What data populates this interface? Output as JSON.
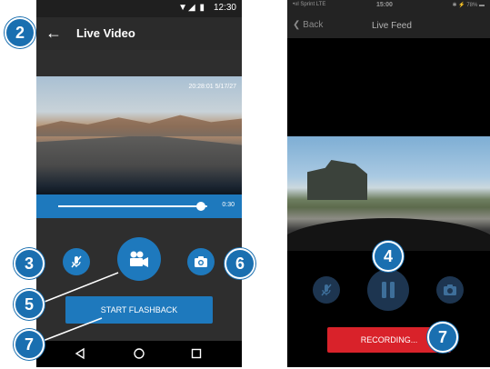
{
  "android": {
    "status": {
      "icons": "▼◢ ▮",
      "time": "12:30"
    },
    "toolbar": {
      "back_glyph": "←",
      "title": "Live Video"
    },
    "video": {
      "timestamp": "20:28:01 5/17/27"
    },
    "seek": {
      "progress": 0.96,
      "time": "0:30"
    },
    "controls": {
      "mic_icon": "mic-off-icon",
      "record_icon": "video-camera-icon",
      "camera_icon": "camera-icon",
      "flashback_label": "START FLASHBACK"
    },
    "nav": {
      "back_glyph": "◁",
      "home_glyph": "○",
      "recent_glyph": "□"
    }
  },
  "ios": {
    "status": {
      "carrier": "•ııl Sprint  LTE",
      "time": "15:00",
      "battery": "✱ ⚡ 78% ▬"
    },
    "nav": {
      "back_label": "❮ Back",
      "title": "Live Feed"
    },
    "controls": {
      "mic_icon": "mic-off-icon",
      "pause_icon": "pause-icon",
      "camera_icon": "camera-icon",
      "recording_label": "RECORDING..."
    }
  },
  "callouts": [
    "2",
    "3",
    "5",
    "6",
    "7",
    "4",
    "7"
  ],
  "colors": {
    "android_accent": "#1e79bd",
    "android_bg": "#2e2e2e",
    "ios_button": "#1d3550",
    "ios_recording": "#d9222a",
    "badge": "#1a6fb0"
  }
}
